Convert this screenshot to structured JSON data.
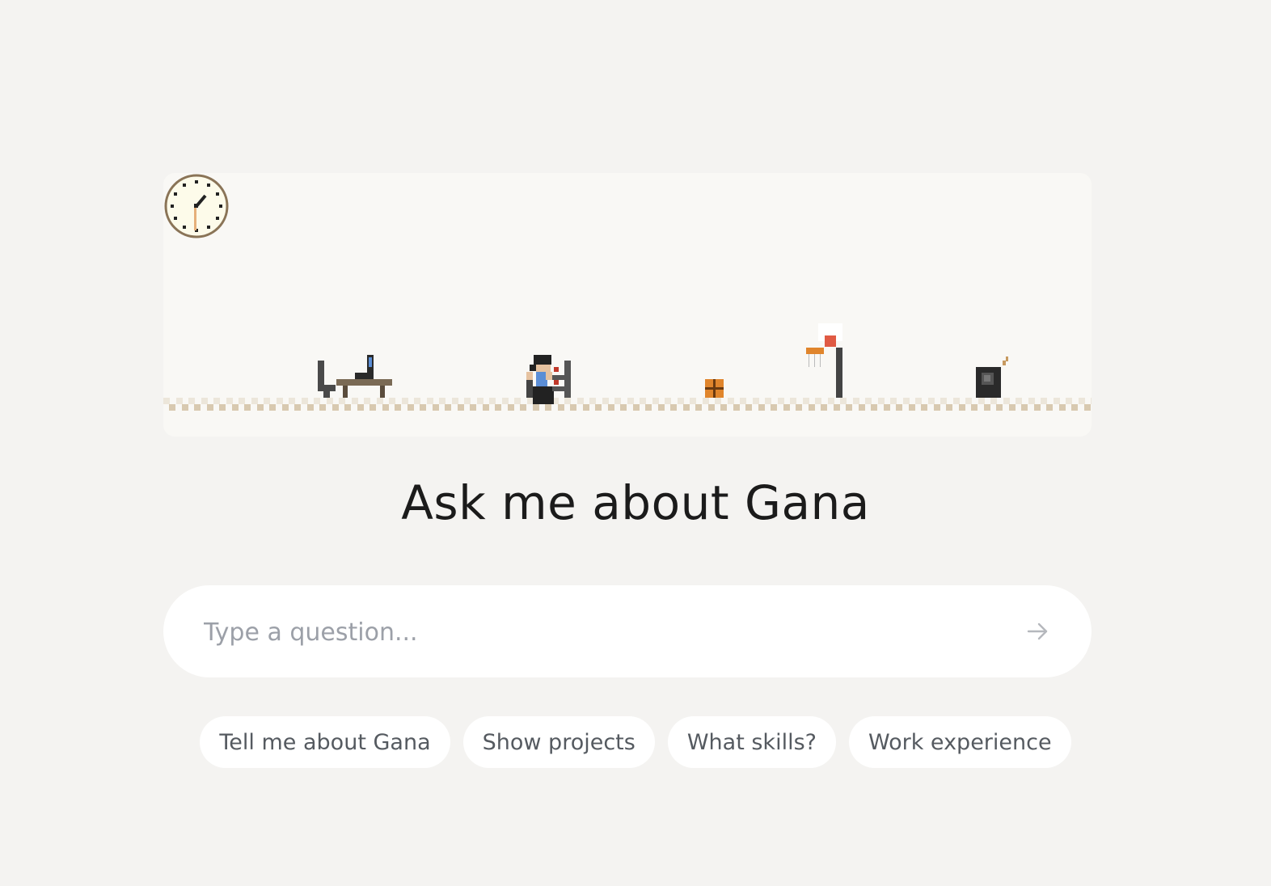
{
  "scene": {
    "icons": [
      "desk-laptop-icon",
      "person-at-desk-icon",
      "box-icon",
      "basketball-hoop-icon",
      "coffee-machine-icon",
      "wall-clock-icon"
    ]
  },
  "heading": "Ask me about Gana",
  "search": {
    "placeholder": "Type a question...",
    "send_icon": "arrow-right-icon"
  },
  "suggestions": [
    "Tell me about Gana",
    "Show projects",
    "What skills?",
    "Work experience"
  ]
}
